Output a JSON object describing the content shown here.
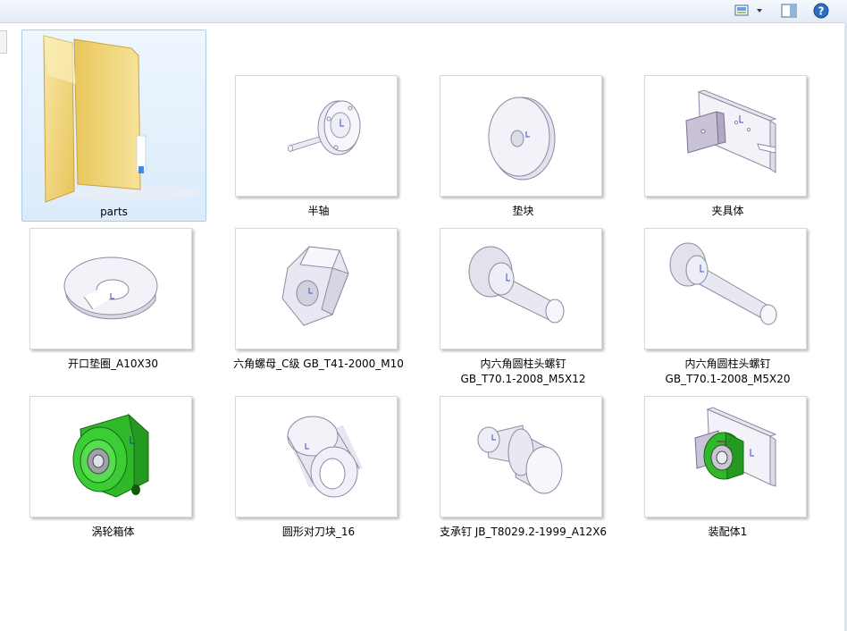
{
  "toolbar": {
    "view_icon": "change-view-icon",
    "view_menu_icon": "chevron-down-icon",
    "preview_pane_icon": "preview-pane-icon",
    "help_icon": "help-icon"
  },
  "items": [
    {
      "name": "parts",
      "type": "folder"
    },
    {
      "name": "半轴",
      "type": "part"
    },
    {
      "name": "垫块",
      "type": "part"
    },
    {
      "name": "夹具体",
      "type": "part"
    },
    {
      "name": "开口垫圈_A10X30",
      "type": "part"
    },
    {
      "name": "六角螺母_C级 GB_T41-2000_M10",
      "type": "part"
    },
    {
      "name_line1": "内六角圆柱头螺钉",
      "name_line2": "GB_T70.1-2008_M5X12",
      "type": "part"
    },
    {
      "name_line1": "内六角圆柱头螺钉",
      "name_line2": "GB_T70.1-2008_M5X20",
      "type": "part"
    },
    {
      "name": "涡轮箱体",
      "type": "part"
    },
    {
      "name": "圆形对刀块_16",
      "type": "part"
    },
    {
      "name": "支承钉 JB_T8029.2-1999_A12X6",
      "type": "part"
    },
    {
      "name": "装配体1",
      "type": "assembly"
    }
  ],
  "colors": {
    "accent_green": "#2fb82a",
    "selection_bg": "#dcebfc",
    "selection_border": "#a7cdf0",
    "folder_yellow": "#f3d77a"
  }
}
